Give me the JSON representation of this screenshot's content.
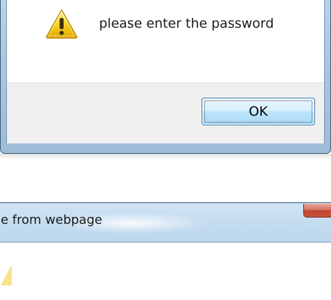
{
  "top_dialog": {
    "message": "please enter the password",
    "icon": "warning-icon",
    "ok_label": "OK"
  },
  "bottom_dialog": {
    "title": "e from webpage",
    "close_icon": "close-icon"
  },
  "colors": {
    "frame_blue": "#a8c6e0",
    "footer_gray": "#f0f0f0",
    "button_border": "#3c7fb1",
    "close_red": "#c2432f",
    "warning_yellow": "#f5c400"
  }
}
